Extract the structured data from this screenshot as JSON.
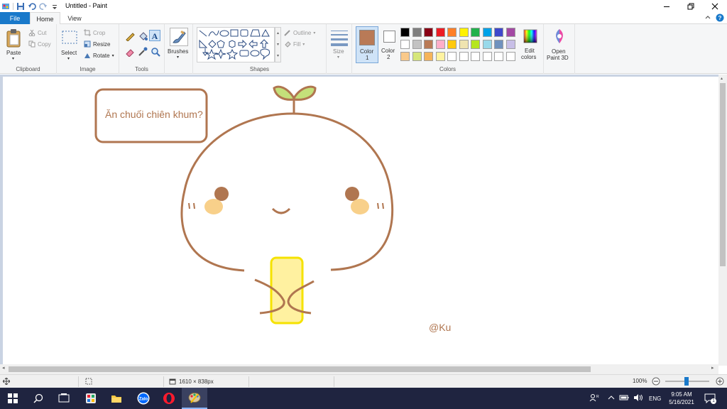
{
  "window": {
    "title": "Untitled - Paint",
    "controls": [
      "minimize",
      "restore",
      "close"
    ]
  },
  "tabs": [
    {
      "label": "File"
    },
    {
      "label": "Home"
    },
    {
      "label": "View"
    }
  ],
  "ribbon": {
    "clipboard": {
      "label": "Clipboard",
      "paste": "Paste",
      "cut": "Cut",
      "copy": "Copy"
    },
    "image": {
      "label": "Image",
      "select": "Select",
      "crop": "Crop",
      "resize": "Resize",
      "rotate": "Rotate"
    },
    "tools": {
      "label": "Tools"
    },
    "brushes": {
      "label": "Brushes"
    },
    "shapes": {
      "label": "Shapes",
      "outline": "Outline",
      "fill": "Fill"
    },
    "size": {
      "label": "Size"
    },
    "colors": {
      "label": "Colors",
      "color1": "Color",
      "color1_num": "1",
      "color2": "Color",
      "color2_num": "2",
      "edit_colors_1": "Edit",
      "edit_colors_2": "colors",
      "color1_value": "#b97a57",
      "color2_value": "#ffffff",
      "palette_row1": [
        "#000000",
        "#7f7f7f",
        "#880015",
        "#ed1c24",
        "#ff7f27",
        "#fff200",
        "#22b14c",
        "#00a2e8",
        "#3f48cc",
        "#a349a4"
      ],
      "palette_row2": [
        "#ffffff",
        "#c3c3c3",
        "#b97a57",
        "#ffaec9",
        "#ffc90e",
        "#efe4b0",
        "#b5e61d",
        "#99d9ea",
        "#7092be",
        "#c8bfe7"
      ],
      "palette_row3": [
        "#f9c98a",
        "#d6e67a",
        "#f6b45a",
        "#fff3a0",
        "#ffffff",
        "#ffffff",
        "#ffffff",
        "#ffffff",
        "#ffffff",
        "#ffffff"
      ]
    },
    "paint3d": {
      "line1": "Open",
      "line2": "Paint 3D"
    }
  },
  "canvas": {
    "speech_text": "Ăn chuối chiên khum?",
    "signature": "@Ku",
    "stroke_color": "#b07650",
    "leaf_color": "#c4e07a",
    "blush_color": "#f8d08a",
    "banana_color": "#fff1a0",
    "banana_outline": "#f5e200"
  },
  "status": {
    "dimensions": "1610 × 838px",
    "zoom": "100%"
  },
  "taskbar": {
    "time": "9:05 AM",
    "date": "5/16/2021",
    "language": "ENG",
    "notification_count": "1",
    "apps": [
      "start-icon",
      "search-icon",
      "task-view-icon",
      "app-icon",
      "file-explorer-icon",
      "zalo-icon",
      "opera-icon",
      "paint-icon"
    ]
  }
}
